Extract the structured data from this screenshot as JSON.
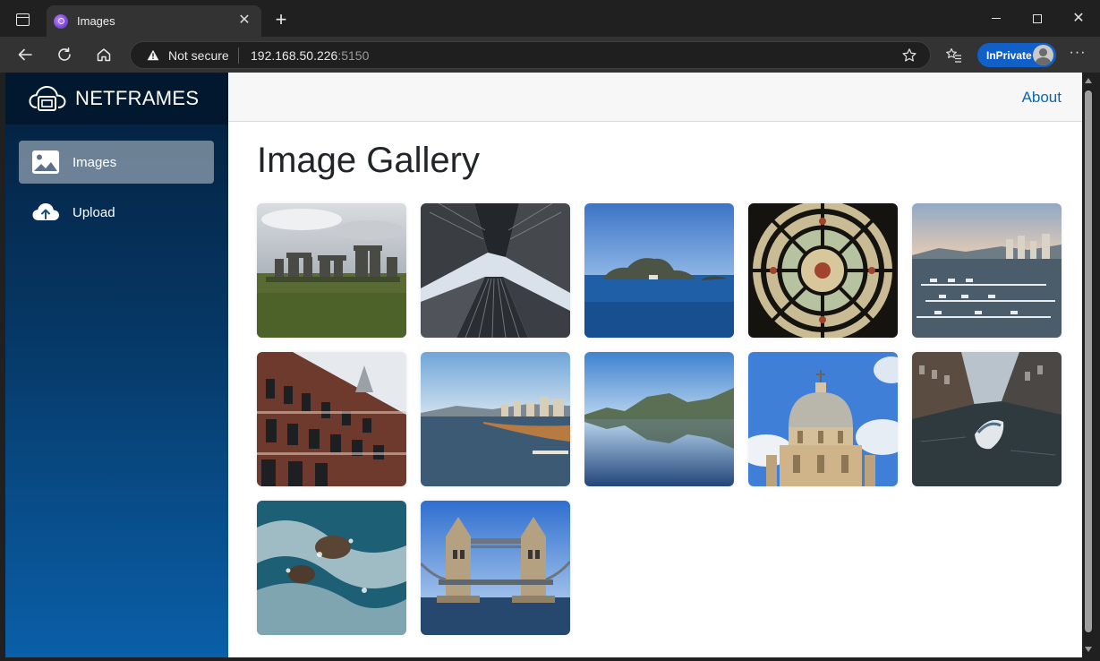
{
  "browser": {
    "tab_title": "Images",
    "address": {
      "security_label": "Not secure",
      "host": "192.168.50.226",
      "port": ":5150"
    },
    "inprivate_label": "InPrivate"
  },
  "app": {
    "brand": "NETFRAMES",
    "nav": [
      {
        "label": "Images",
        "icon": "image-icon",
        "active": true
      },
      {
        "label": "Upload",
        "icon": "cloud-upload-icon",
        "active": false
      }
    ],
    "topbar": {
      "about_label": "About"
    }
  },
  "gallery": {
    "title": "Image Gallery",
    "images": [
      {
        "subject": "stonehenge"
      },
      {
        "subject": "skyscrapers-looking-up"
      },
      {
        "subject": "rocky-island-sea"
      },
      {
        "subject": "stained-glass-dome"
      },
      {
        "subject": "marina-city"
      },
      {
        "subject": "gothic-brick-building"
      },
      {
        "subject": "waterfront-city"
      },
      {
        "subject": "mountain-lake-reflection"
      },
      {
        "subject": "cathedral-dome"
      },
      {
        "subject": "canal-boat"
      },
      {
        "subject": "ocean-rocks-waves"
      },
      {
        "subject": "tower-bridge"
      }
    ]
  }
}
